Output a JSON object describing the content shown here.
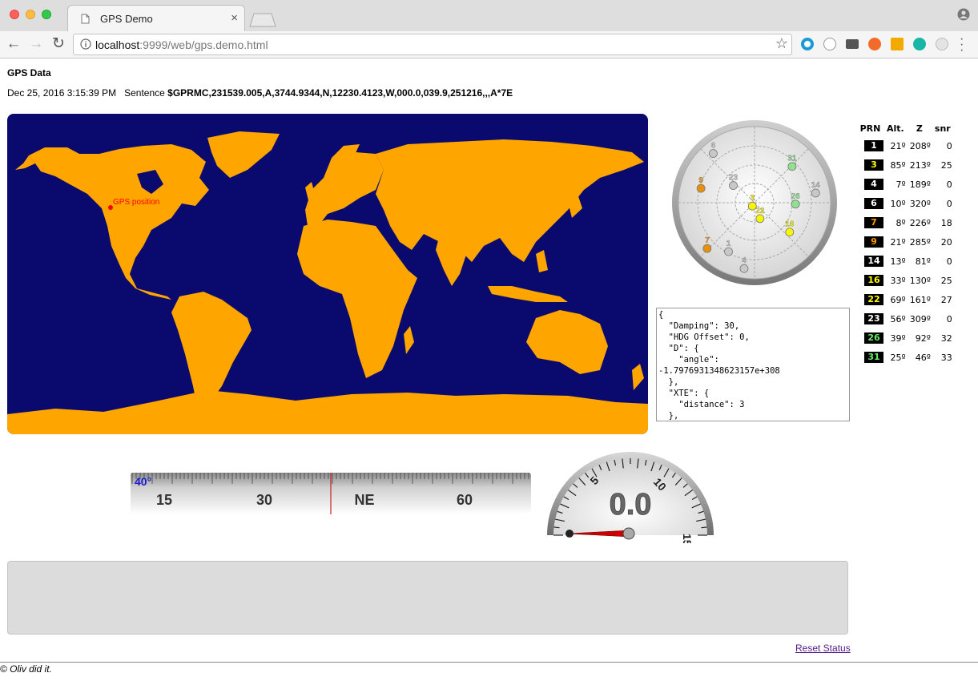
{
  "browser": {
    "tab_title": "GPS Demo",
    "url_host": "localhost",
    "url_rest": ":9999/web/gps.demo.html"
  },
  "page": {
    "title": "GPS Data",
    "date": "Dec 25, 2016 3:15:39 PM",
    "sentence_label": "Sentence",
    "sentence_value": "$GPRMC,231539.005,A,3744.9344,N,12230.4123,W,000.0,039.9,251216,,,A*7E"
  },
  "map": {
    "marker_label": "GPS position",
    "ocean_color": "#0a0a6e",
    "land_color": "#ffa500",
    "marker_color": "#ff0000"
  },
  "satellite_plot": {
    "points": [
      {
        "prn": "3",
        "color": "#f6f600"
      },
      {
        "prn": "4",
        "color": "#c8c8c8"
      },
      {
        "prn": "6",
        "color": "#c8c8c8"
      },
      {
        "prn": "7",
        "color": "#e8900a"
      },
      {
        "prn": "9",
        "color": "#e8900a"
      },
      {
        "prn": "14",
        "color": "#c8c8c8"
      },
      {
        "prn": "16",
        "color": "#f6f600"
      },
      {
        "prn": "22",
        "color": "#f6f600"
      },
      {
        "prn": "23",
        "color": "#c8c8c8"
      },
      {
        "prn": "26",
        "color": "#8fe08f"
      },
      {
        "prn": "31",
        "color": "#8fe08f"
      },
      {
        "prn": "1",
        "color": "#c8c8c8"
      }
    ]
  },
  "json_text": "{\n  \"Damping\": 30,\n  \"HDG Offset\": 0,\n  \"D\": {\n    \"angle\":\n-1.7976931348623157e+308\n  },\n  \"XTE\": {\n    \"distance\": 3\n  },",
  "sat_table": {
    "headers": [
      "PRN",
      "Alt.",
      "Z",
      "snr"
    ],
    "rows": [
      {
        "prn": "1",
        "alt": "21º",
        "z": "208º",
        "snr": "0",
        "color": "#ffffff"
      },
      {
        "prn": "3",
        "alt": "85º",
        "z": "213º",
        "snr": "25",
        "color": "#ffff00"
      },
      {
        "prn": "4",
        "alt": "7º",
        "z": "189º",
        "snr": "0",
        "color": "#ffffff"
      },
      {
        "prn": "6",
        "alt": "10º",
        "z": "320º",
        "snr": "0",
        "color": "#ffffff"
      },
      {
        "prn": "7",
        "alt": "8º",
        "z": "226º",
        "snr": "18",
        "color": "#ff9900"
      },
      {
        "prn": "9",
        "alt": "21º",
        "z": "285º",
        "snr": "20",
        "color": "#ff9900"
      },
      {
        "prn": "14",
        "alt": "13º",
        "z": "81º",
        "snr": "0",
        "color": "#ffffff"
      },
      {
        "prn": "16",
        "alt": "33º",
        "z": "130º",
        "snr": "25",
        "color": "#ffff00"
      },
      {
        "prn": "22",
        "alt": "69º",
        "z": "161º",
        "snr": "27",
        "color": "#ffff00"
      },
      {
        "prn": "23",
        "alt": "56º",
        "z": "309º",
        "snr": "0",
        "color": "#ffffff"
      },
      {
        "prn": "26",
        "alt": "39º",
        "z": "92º",
        "snr": "32",
        "color": "#66ee66"
      },
      {
        "prn": "31",
        "alt": "25º",
        "z": "46º",
        "snr": "33",
        "color": "#66ee66"
      }
    ]
  },
  "compass": {
    "heading_label": "40°",
    "heading": 40,
    "labels": [
      "15",
      "30",
      "NE",
      "60"
    ]
  },
  "speedometer": {
    "value": "0.0",
    "speed": 0,
    "ticks": [
      "5",
      "10",
      "15"
    ]
  },
  "footer": {
    "reset_label": "Reset Status",
    "credit": "© Oliv did it."
  }
}
